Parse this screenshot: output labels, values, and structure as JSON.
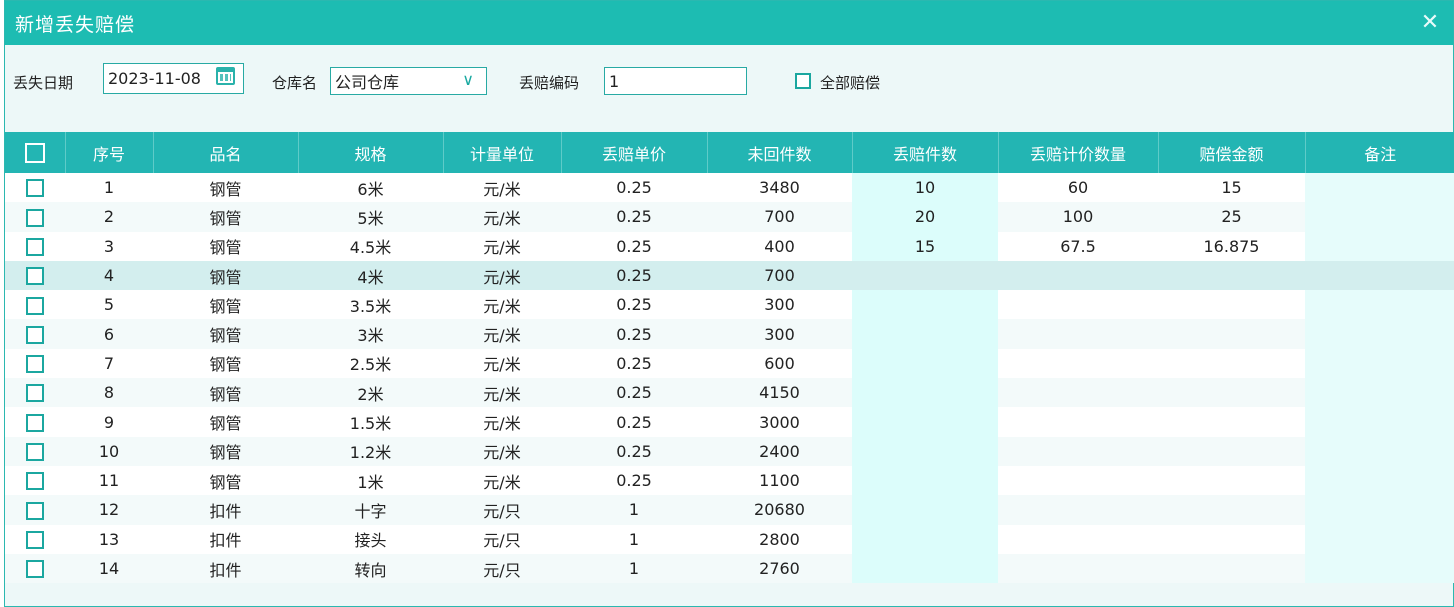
{
  "dialog": {
    "title": "新增丢失赔偿",
    "close_icon": "close-icon"
  },
  "filters": {
    "date_label": "丢失日期",
    "date_value": "2023-11-08",
    "warehouse_label": "仓库名",
    "warehouse_value": "公司仓库",
    "code_label": "丢赔编码",
    "code_value": "1",
    "all_comp_label": "全部赔偿"
  },
  "colors": {
    "accent": "#1dbcb2",
    "header": "#23b5b3",
    "selected_row": "#d3eeee"
  },
  "table": {
    "headers": [
      "",
      "序号",
      "品名",
      "规格",
      "计量单位",
      "丢赔单价",
      "未回件数",
      "丢赔件数",
      "丢赔计价数量",
      "赔偿金额",
      "备注"
    ],
    "rows": [
      {
        "no": "1",
        "name": "钢管",
        "spec": "6米",
        "unit": "元/米",
        "price": "0.25",
        "unreturned": "3480",
        "lost": "10",
        "qty": "60",
        "amount": "15",
        "note": ""
      },
      {
        "no": "2",
        "name": "钢管",
        "spec": "5米",
        "unit": "元/米",
        "price": "0.25",
        "unreturned": "700",
        "lost": "20",
        "qty": "100",
        "amount": "25",
        "note": ""
      },
      {
        "no": "3",
        "name": "钢管",
        "spec": "4.5米",
        "unit": "元/米",
        "price": "0.25",
        "unreturned": "400",
        "lost": "15",
        "qty": "67.5",
        "amount": "16.875",
        "note": ""
      },
      {
        "no": "4",
        "name": "钢管",
        "spec": "4米",
        "unit": "元/米",
        "price": "0.25",
        "unreturned": "700",
        "lost": "",
        "qty": "",
        "amount": "",
        "note": ""
      },
      {
        "no": "5",
        "name": "钢管",
        "spec": "3.5米",
        "unit": "元/米",
        "price": "0.25",
        "unreturned": "300",
        "lost": "",
        "qty": "",
        "amount": "",
        "note": ""
      },
      {
        "no": "6",
        "name": "钢管",
        "spec": "3米",
        "unit": "元/米",
        "price": "0.25",
        "unreturned": "300",
        "lost": "",
        "qty": "",
        "amount": "",
        "note": ""
      },
      {
        "no": "7",
        "name": "钢管",
        "spec": "2.5米",
        "unit": "元/米",
        "price": "0.25",
        "unreturned": "600",
        "lost": "",
        "qty": "",
        "amount": "",
        "note": ""
      },
      {
        "no": "8",
        "name": "钢管",
        "spec": "2米",
        "unit": "元/米",
        "price": "0.25",
        "unreturned": "4150",
        "lost": "",
        "qty": "",
        "amount": "",
        "note": ""
      },
      {
        "no": "9",
        "name": "钢管",
        "spec": "1.5米",
        "unit": "元/米",
        "price": "0.25",
        "unreturned": "3000",
        "lost": "",
        "qty": "",
        "amount": "",
        "note": ""
      },
      {
        "no": "10",
        "name": "钢管",
        "spec": "1.2米",
        "unit": "元/米",
        "price": "0.25",
        "unreturned": "2400",
        "lost": "",
        "qty": "",
        "amount": "",
        "note": ""
      },
      {
        "no": "11",
        "name": "钢管",
        "spec": "1米",
        "unit": "元/米",
        "price": "0.25",
        "unreturned": "1100",
        "lost": "",
        "qty": "",
        "amount": "",
        "note": ""
      },
      {
        "no": "12",
        "name": "扣件",
        "spec": "十字",
        "unit": "元/只",
        "price": "1",
        "unreturned": "20680",
        "lost": "",
        "qty": "",
        "amount": "",
        "note": ""
      },
      {
        "no": "13",
        "name": "扣件",
        "spec": "接头",
        "unit": "元/只",
        "price": "1",
        "unreturned": "2800",
        "lost": "",
        "qty": "",
        "amount": "",
        "note": ""
      },
      {
        "no": "14",
        "name": "扣件",
        "spec": "转向",
        "unit": "元/只",
        "price": "1",
        "unreturned": "2760",
        "lost": "",
        "qty": "",
        "amount": "",
        "note": ""
      }
    ]
  }
}
